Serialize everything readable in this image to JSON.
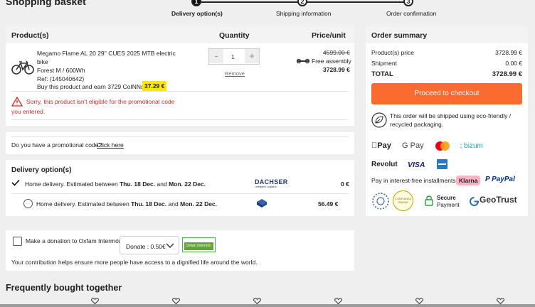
{
  "page": {
    "title": "Shopping basket"
  },
  "steps": [
    {
      "num": "1",
      "label": "Delivery option(s)"
    },
    {
      "num": "2",
      "label": "Shipping information"
    },
    {
      "num": "3",
      "label": "Order confirmation"
    }
  ],
  "cart": {
    "col_product": "Product(s)",
    "col_quantity": "Quantity",
    "col_price": "Price/unit",
    "product": {
      "name_line1": "Megamo Flame AL 20 29'' CUES 2025 MTB electric",
      "name_line2": "bike",
      "variant": "Forest M / 600Wh",
      "ref": "Ref: (145040642)",
      "earn_text": "Buy this product and earn 3729 CoINNs /",
      "earn_badge": "37.29 €",
      "old_price": "4599.00 €",
      "assembly": "Free assembly",
      "price": "3728.99 €",
      "quantity": "1",
      "minus": "-",
      "plus": "+",
      "remove": "Remove"
    },
    "warning_line1": "Sorry, this product isn't eligible for the promotional code",
    "warning_line2": "you entered."
  },
  "promo": {
    "text": "Do you have a promotional code?",
    "link": "Click here"
  },
  "delivery": {
    "title": "Delivery option(s)",
    "options": [
      {
        "pre": "Home delivery. Estimated between ",
        "d1": "Thu. 18 Dec.",
        "mid": " and ",
        "d2": "Mon. 22 Dec.",
        "carrier": "DACHSER",
        "carrier_sub": "Intelligent Logistics",
        "price": "0 €"
      },
      {
        "pre": "Home delivery. Estimated between ",
        "d1": "Thu. 18 Dec.",
        "mid": " and ",
        "d2": "Mon. 22 Dec.",
        "price": "56.49 €"
      }
    ]
  },
  "donation": {
    "label": "Make a donation to Oxfam Intermón",
    "select_value": "Donate : 0.50€",
    "logo_text": "Oxfam Intermón",
    "note": "Your contribution helps ensure more people have access to a dignified life around the world."
  },
  "summary": {
    "title": "Order summary",
    "rows": [
      {
        "label": "Product(s) price",
        "value": "3728.99 €"
      },
      {
        "label": "Shipment",
        "value": "0.00 €"
      }
    ],
    "total_label": "TOTAL",
    "total_value": "3728.99 €",
    "checkout_label": "Proceed to checkout",
    "eco_line1": "This order will be shipped using eco-friendly /",
    "eco_line2": "recycled packaging.",
    "pay_apple": "Pay",
    "pay_google": "G Pay",
    "pay_bizum": "bizum",
    "pay_revolut": "Revolut",
    "pay_visa": "VISA",
    "installments": "Pay in interest-free installments:",
    "klarna": "Klarna",
    "paypal": "PayPal",
    "secure1": "Secure",
    "secure2": "Payment",
    "geotrust": "GeoTrust",
    "confianza": "CONFIANZA ONLINE"
  },
  "fbt": {
    "title": "Frequently bought together"
  },
  "colors": {
    "accent": "#fb6a2e",
    "badge": "#ffe600",
    "warning": "#d92b2b",
    "link": "#1a1a1a"
  }
}
